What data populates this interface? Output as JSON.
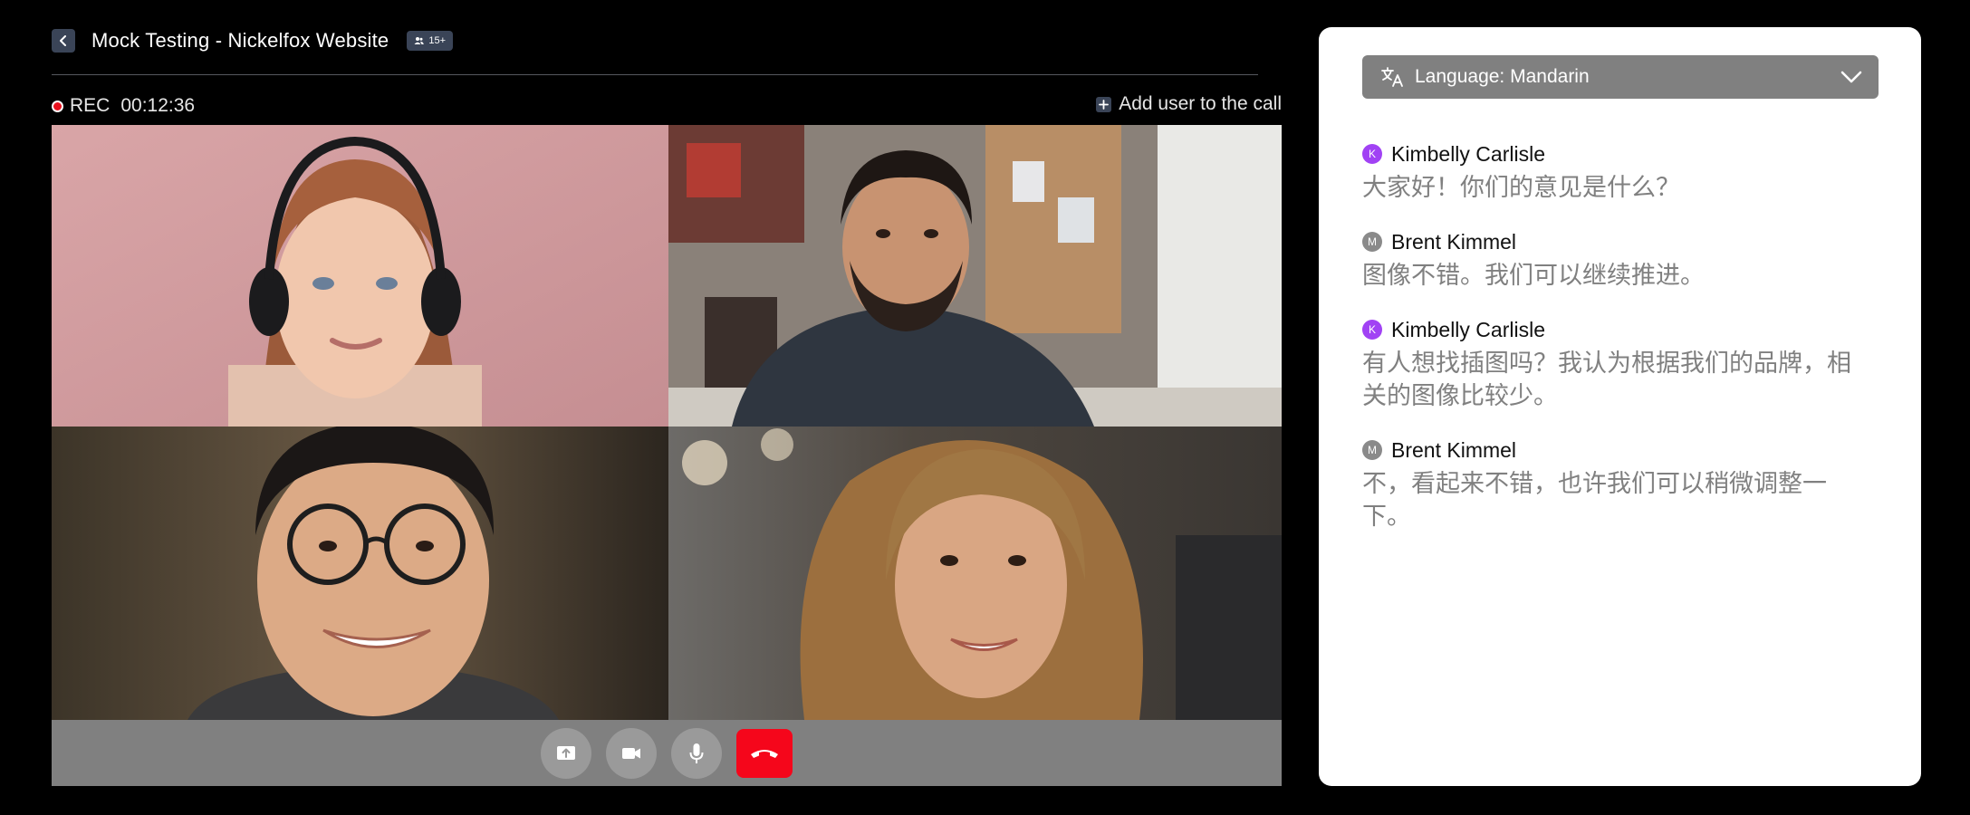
{
  "header": {
    "title": "Mock Testing - Nickelfox Website",
    "participants_badge": "15+"
  },
  "recording": {
    "label": "REC",
    "time": "00:12:36"
  },
  "add_user_label": "Add user to the call",
  "controls": {
    "icons": [
      "share-screen-icon",
      "video-camera-icon",
      "microphone-icon",
      "end-call-icon"
    ]
  },
  "transcript": {
    "language_label": "Language: Mandarin",
    "messages": [
      {
        "initial": "K",
        "sender": "Kimbelly Carlisle",
        "text": "大家好！你们的意见是什么？"
      },
      {
        "initial": "M",
        "sender": "Brent Kimmel",
        "text": "图像不错。我们可以继续推进。"
      },
      {
        "initial": "K",
        "sender": "Kimbelly Carlisle",
        "text": "有人想找插图吗？我认为根据我们的品牌，相关的图像比较少。"
      },
      {
        "initial": "M",
        "sender": "Brent Kimmel",
        "text": "不，看起来不错，也许我们可以稍微调整一下。"
      }
    ]
  },
  "colors": {
    "accent_badge": "#3a4457",
    "end_call": "#f5061b",
    "avatar_k": "#a142f4",
    "avatar_m": "#8a8a8a",
    "rec_dot": "#e8101d"
  }
}
